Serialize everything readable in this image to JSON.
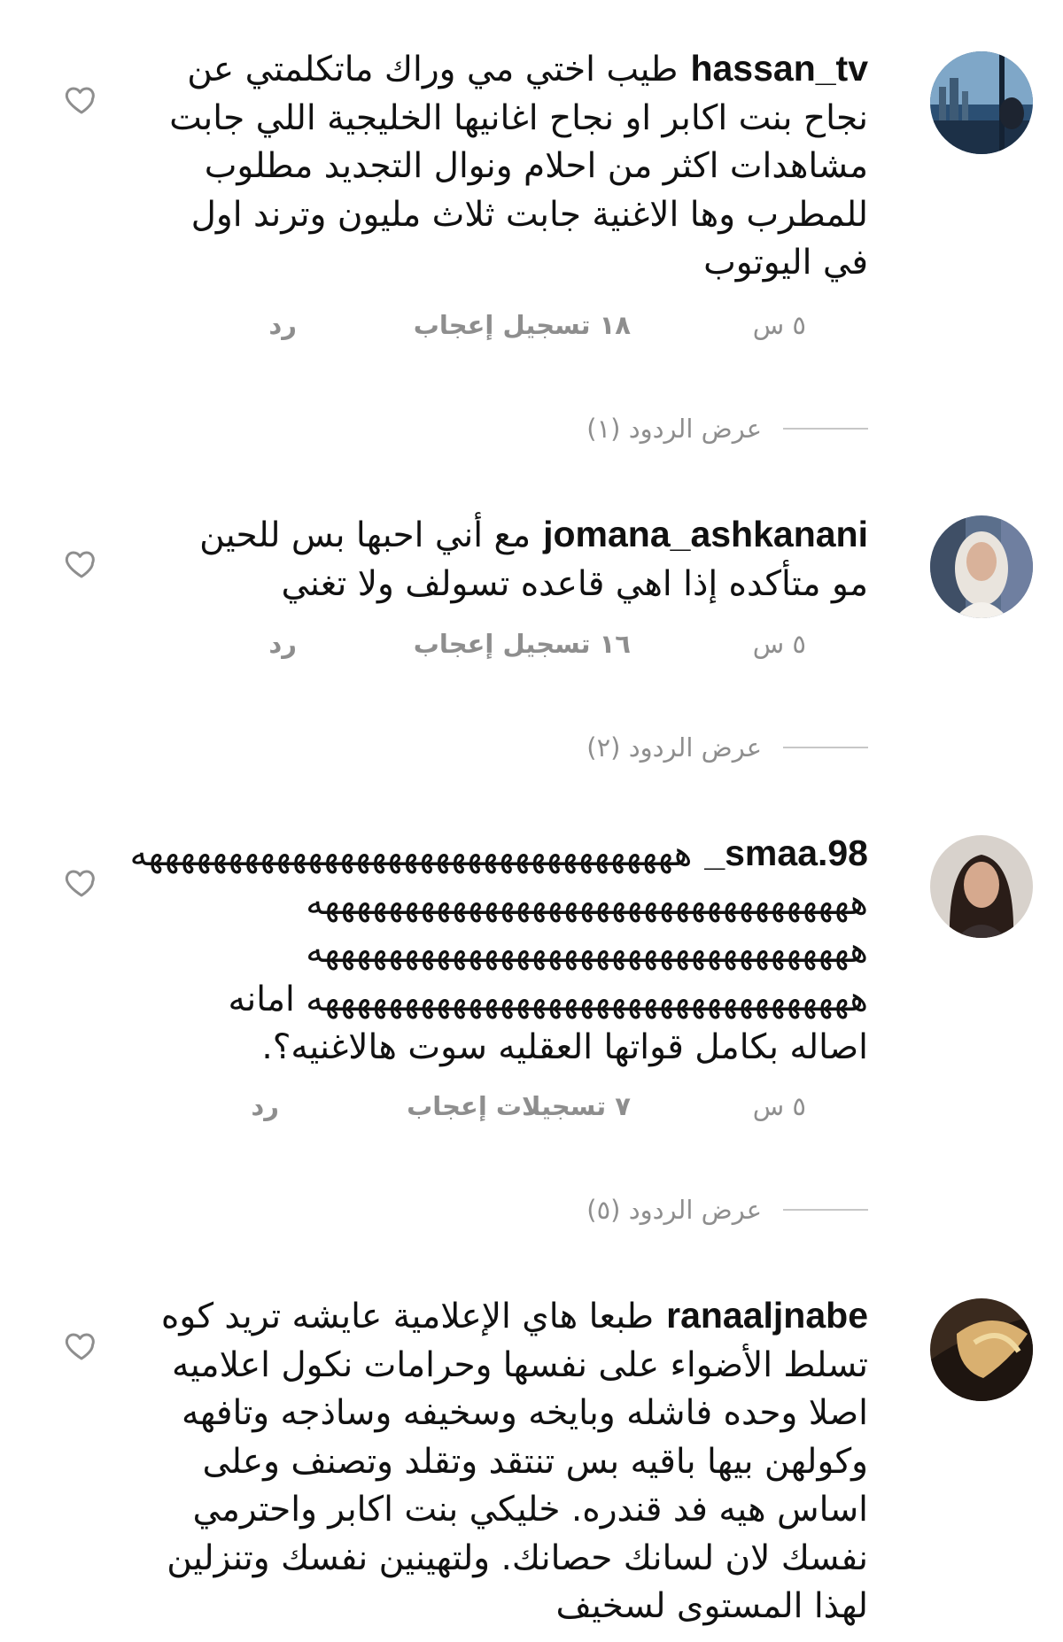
{
  "comments": [
    {
      "username": "hassan_tv",
      "text": "طيب اختي مي وراك ماتكلمتي عن نجاح بنت اكابر او نجاح اغانيها الخليجية اللي جابت مشاهدات اكثر من احلام ونوال التجديد مطلوب للمطرب وها الاغنية جابت ثلاث مليون وترند اول في اليوتوب",
      "time": "٥ س",
      "likes": "١٨ تسجيل إعجاب",
      "reply": "رد",
      "view_replies": "عرض الردود (١)"
    },
    {
      "username": "jomana_ashkanani",
      "text": "مع أني احبها بس للحين مو متأكده إذا اهي قاعده تسولف ولا تغني",
      "time": "٥ س",
      "likes": "١٦ تسجيل إعجاب",
      "reply": "رد",
      "view_replies": "عرض الردود (٢)"
    },
    {
      "username": "_smaa.98",
      "text": "ههههههههههههههههههههههههههههههههههه ههههههههههههههههههههههههههههههههههه ههههههههههههههههههههههههههههههههههه ههههههههههههههههههههههههههههههههههه امانه اصاله بكامل قواتها العقليه سوت هالاغنيه؟.",
      "time": "٥ س",
      "likes": "٧ تسجيلات إعجاب",
      "reply": "رد",
      "view_replies": "عرض الردود (٥)"
    },
    {
      "username": "ranaaljnabe",
      "text": "طبعا هاي الإعلامية عايشه تريد كوه تسلط الأضواء على نفسها وحرامات نكول اعلاميه اصلا وحده فاشله وبايخه وسخيفه وساذجه وتافهه وكولهن بيها باقيه بس تنتقد وتقلد وتصنف وعلى اساس هيه فد قندره. خليكي بنت اكابر واحترمي نفسك لان لسانك حصانك. ولتهينين نفسك وتنزلين لهذا المستوى لسخيف"
    }
  ],
  "icons": {
    "like": "heart-outline-icon"
  },
  "colors": {
    "meta": "#8e8e8e",
    "text": "#111111",
    "divider": "#c7c7c7"
  }
}
